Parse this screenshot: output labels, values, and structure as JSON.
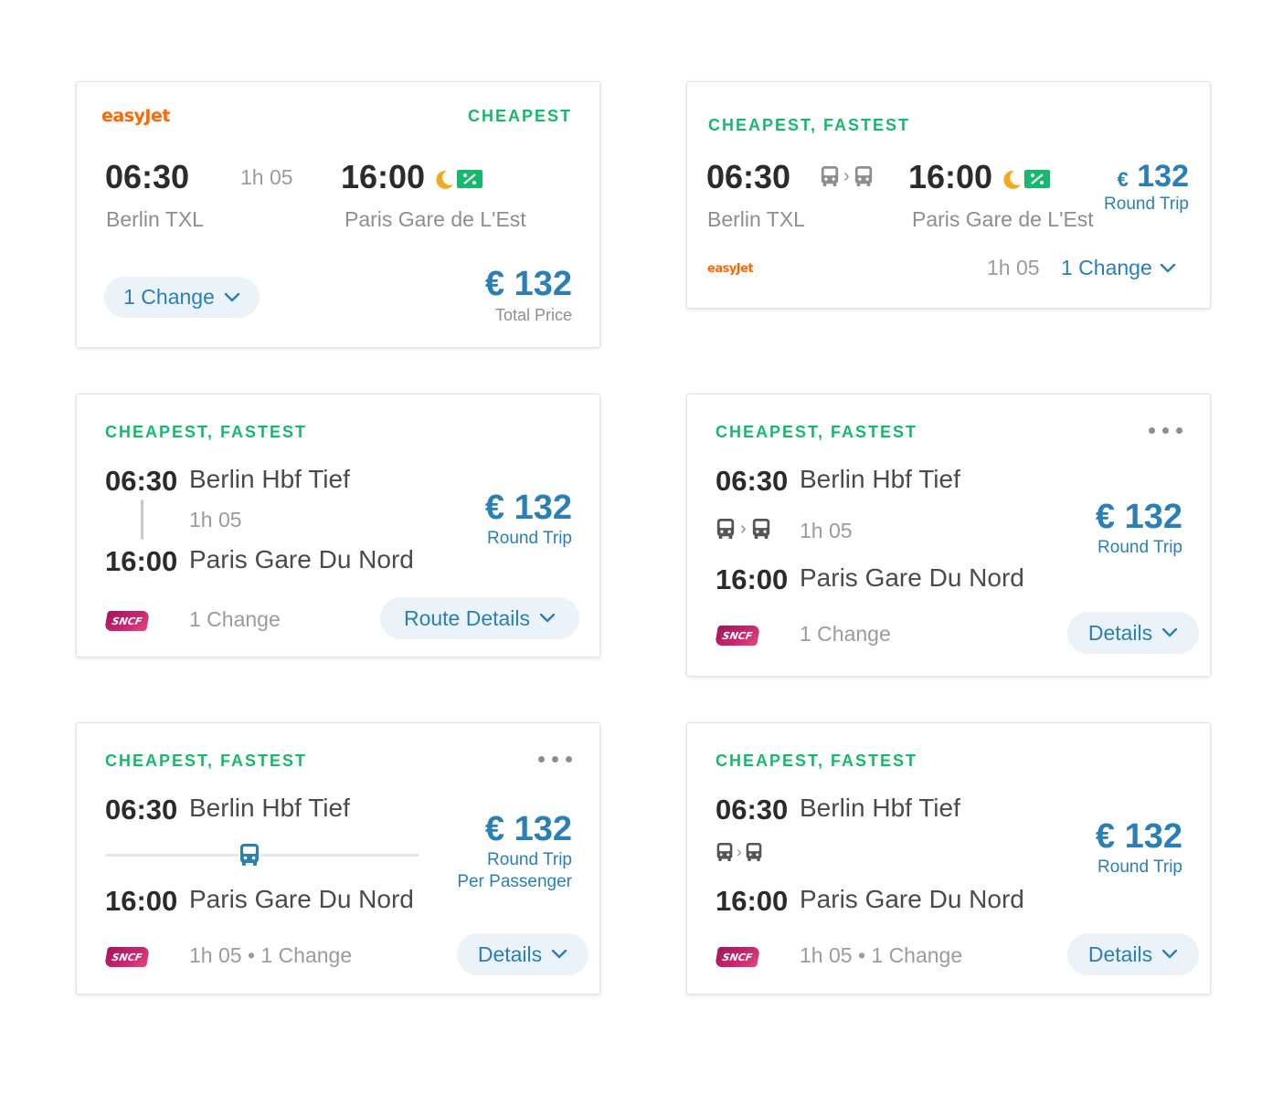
{
  "colors": {
    "tag_green": "#16b86e",
    "price_blue": "#2a7fb6",
    "pill_bg": "#ebf3f9",
    "easyjet_orange": "#ff6600",
    "sncf_magenta": "#b81c63"
  },
  "icons": {
    "night": "moon-icon",
    "ticket": "ticket-icon",
    "bus": "bus-icon",
    "chevron": "chevron-down-icon",
    "more": "more-dots-icon"
  },
  "card1": {
    "carrier": "easyJet",
    "tag": "CHEAPEST",
    "dep_time": "06:30",
    "duration": "1h 05",
    "arr_time": "16:00",
    "dep_station": "Berlin TXL",
    "arr_station": "Paris Gare de L'Est",
    "changes": "1 Change",
    "price": "€ 132",
    "price_label": "Total Price"
  },
  "card2": {
    "tag": "CHEAPEST, FASTEST",
    "dep_time": "06:30",
    "arr_time": "16:00",
    "dep_station": "Berlin TXL",
    "arr_station": "Paris Gare de L'Est",
    "currency": "€",
    "amount": "132",
    "price_label": "Round Trip",
    "carrier": "easyJet",
    "duration": "1h 05",
    "changes": "1 Change"
  },
  "card3": {
    "tag": "CHEAPEST, FASTEST",
    "dep_time": "06:30",
    "dep_station": "Berlin Hbf Tief",
    "duration": "1h 05",
    "arr_time": "16:00",
    "arr_station": "Paris Gare Du Nord",
    "price": "€ 132",
    "price_label": "Round Trip",
    "carrier": "SNCF",
    "changes": "1 Change",
    "details": "Route Details"
  },
  "card4": {
    "tag": "CHEAPEST, FASTEST",
    "dep_time": "06:30",
    "dep_station": "Berlin Hbf Tief",
    "duration": "1h 05",
    "arr_time": "16:00",
    "arr_station": "Paris Gare Du Nord",
    "price": "€ 132",
    "price_label": "Round Trip",
    "carrier": "SNCF",
    "changes": "1 Change",
    "details": "Details"
  },
  "card5": {
    "tag": "CHEAPEST, FASTEST",
    "dep_time": "06:30",
    "dep_station": "Berlin Hbf Tief",
    "arr_time": "16:00",
    "arr_station": "Paris Gare Du Nord",
    "price": "€ 132",
    "price_label": "Round Trip",
    "price_sub": "Per Passenger",
    "carrier": "SNCF",
    "meta": "1h 05 • 1 Change",
    "details": "Details"
  },
  "card6": {
    "tag": "CHEAPEST, FASTEST",
    "dep_time": "06:30",
    "dep_station": "Berlin Hbf Tief",
    "arr_time": "16:00",
    "arr_station": "Paris Gare Du Nord",
    "price": "€ 132",
    "price_label": "Round Trip",
    "carrier": "SNCF",
    "meta": "1h 05 • 1 Change",
    "details": "Details"
  }
}
